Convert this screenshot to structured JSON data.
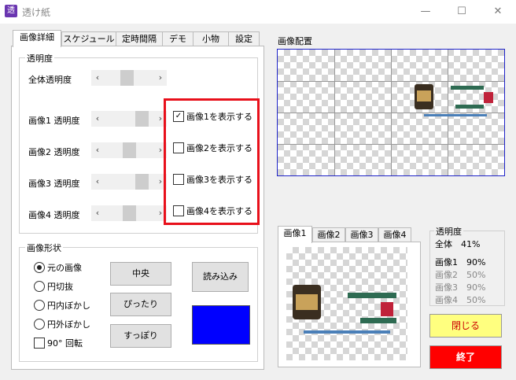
{
  "window": {
    "title": "透け紙",
    "icon_char": "透",
    "minimize": "—",
    "maximize": "☐",
    "close": "✕"
  },
  "tabs": [
    "画像詳細",
    "スケジュール",
    "定時間隔",
    "デモ",
    "小物",
    "設定"
  ],
  "active_tab": 0,
  "transparency": {
    "group_label": "透明度",
    "overall_label": "全体透明度",
    "overall_level": 0.45,
    "rows": [
      {
        "label": "画像1 透明度",
        "level": 0.85,
        "checkbox_label": "画像1を表示する",
        "checked": true
      },
      {
        "label": "画像2 透明度",
        "level": 0.5,
        "checkbox_label": "画像2を表示する",
        "checked": false
      },
      {
        "label": "画像3 透明度",
        "level": 0.85,
        "checkbox_label": "画像3を表示する",
        "checked": false
      },
      {
        "label": "画像4 透明度",
        "level": 0.5,
        "checkbox_label": "画像4を表示する",
        "checked": false
      }
    ],
    "highlight_color": "#e8101b"
  },
  "shape": {
    "group_label": "画像形状",
    "options": [
      {
        "label": "元の画像",
        "selected": true
      },
      {
        "label": "円切抜",
        "selected": false
      },
      {
        "label": "円内ぼかし",
        "selected": false
      },
      {
        "label": "円外ぼかし",
        "selected": false
      }
    ],
    "rotate_label": "90°  回転",
    "rotate_checked": false,
    "buttons": {
      "center": "中央",
      "fit": "ぴったり",
      "cover": "すっぽり",
      "load": "読み込み"
    },
    "color_swatch": "#0000ff"
  },
  "placement": {
    "label": "画像配置",
    "frame_color": "#1e22c8"
  },
  "preview": {
    "tabs": [
      "画像1",
      "画像2",
      "画像3",
      "画像4"
    ],
    "active_tab": 0
  },
  "summary": {
    "group_label": "透明度",
    "overall": "全体　41%",
    "rows": [
      {
        "text": "画像1　90%",
        "active": true
      },
      {
        "text": "画像2　50%",
        "active": false
      },
      {
        "text": "画像3　90%",
        "active": false
      },
      {
        "text": "画像4　50%",
        "active": false
      }
    ]
  },
  "actions": {
    "close_label": "閉じる",
    "close_color": "#ffff7f",
    "exit_label": "終了",
    "exit_color": "#ff0000"
  }
}
